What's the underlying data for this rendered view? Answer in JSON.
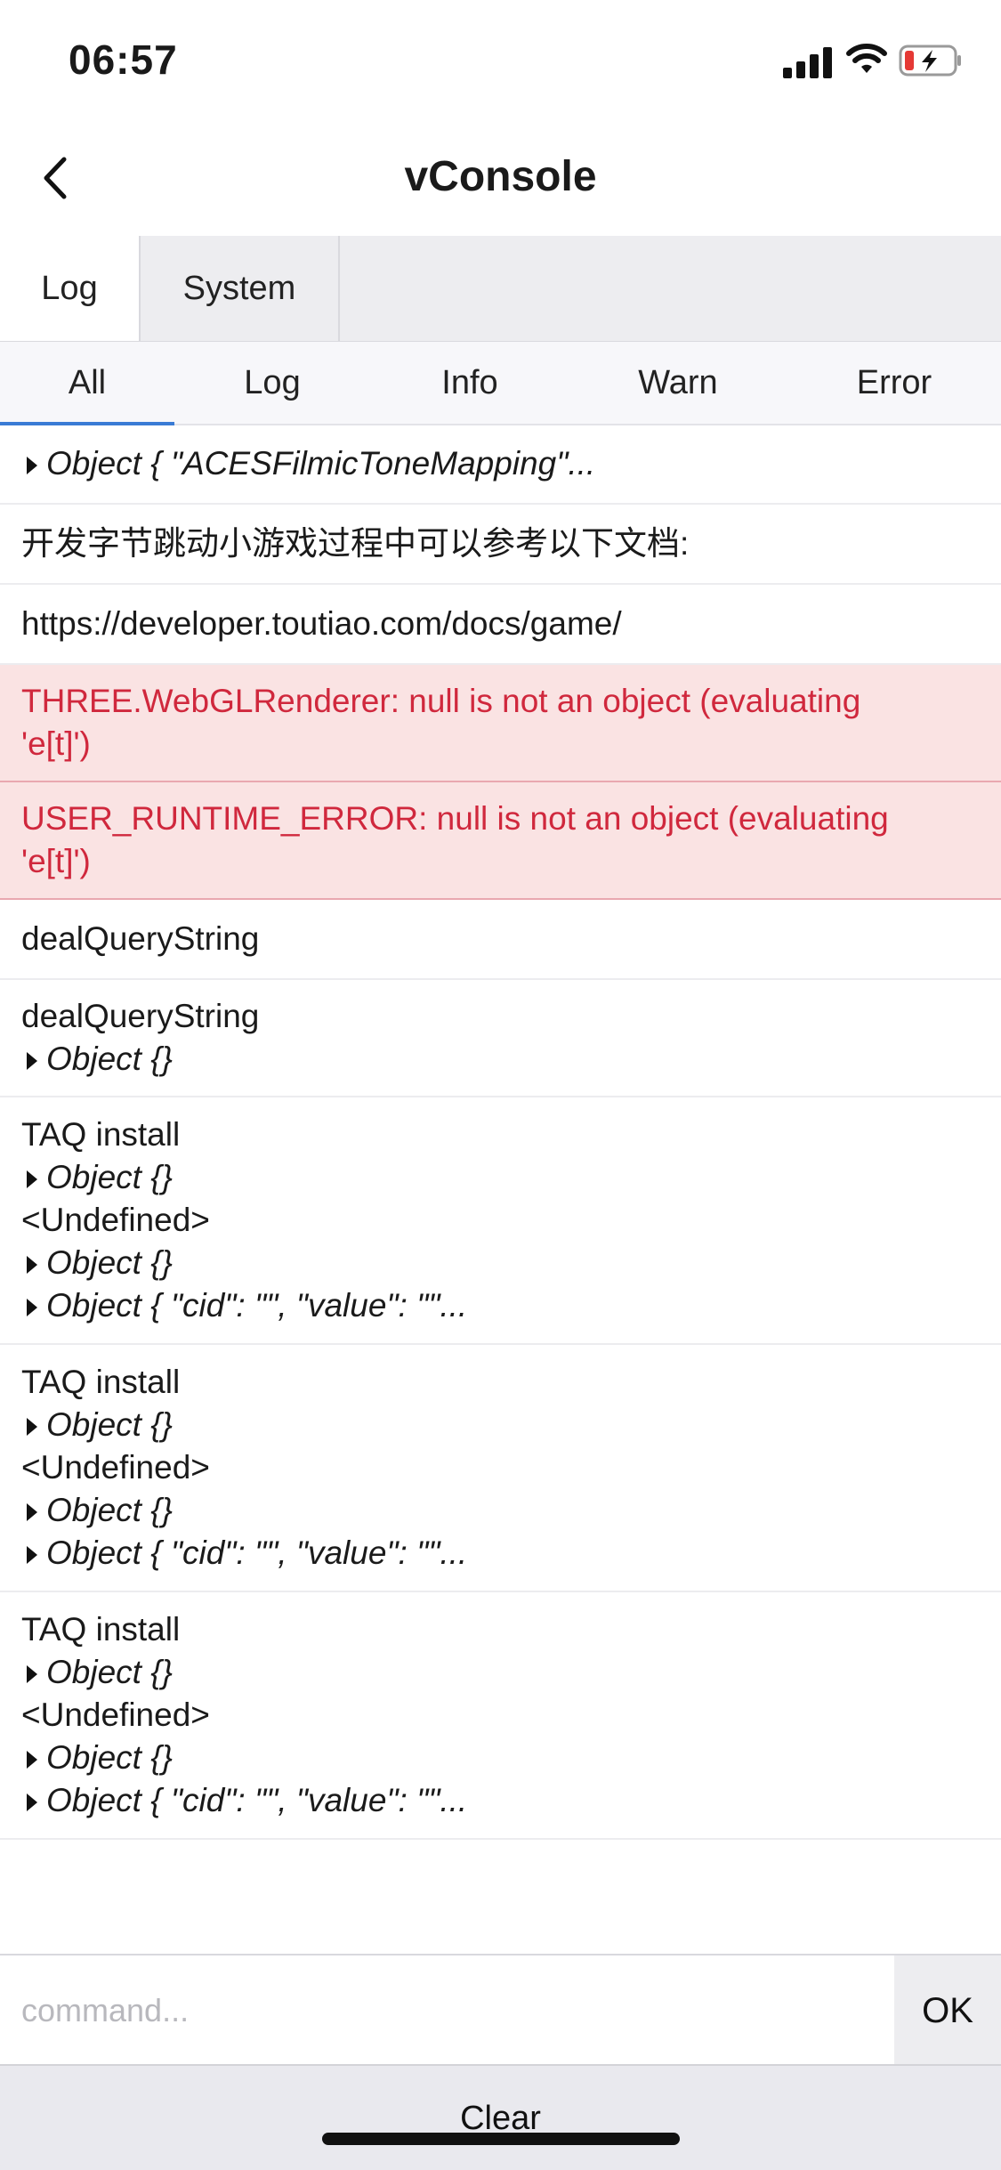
{
  "status": {
    "time": "06:57"
  },
  "nav": {
    "title": "vConsole"
  },
  "top_tabs": [
    "Log",
    "System"
  ],
  "sub_tabs": [
    "All",
    "Log",
    "Info",
    "Warn",
    "Error"
  ],
  "logs": [
    {
      "type": "log",
      "lines": [
        {
          "kind": "obj",
          "text": "Object { \"ACESFilmicToneMapping\"..."
        }
      ]
    },
    {
      "type": "log",
      "lines": [
        {
          "kind": "text",
          "text": "开发字节跳动小游戏过程中可以参考以下文档:"
        }
      ]
    },
    {
      "type": "log",
      "lines": [
        {
          "kind": "text",
          "text": "https://developer.toutiao.com/docs/game/"
        }
      ]
    },
    {
      "type": "error",
      "lines": [
        {
          "kind": "text",
          "text": "THREE.WebGLRenderer: null is not an object (evaluating"
        },
        {
          "kind": "text",
          "text": "'e[t]')"
        }
      ]
    },
    {
      "type": "error",
      "lines": [
        {
          "kind": "text",
          "text": "USER_RUNTIME_ERROR: null is not an object (evaluating"
        },
        {
          "kind": "text",
          "text": "'e[t]')"
        }
      ]
    },
    {
      "type": "log",
      "lines": [
        {
          "kind": "text",
          "text": "dealQueryString"
        }
      ]
    },
    {
      "type": "log",
      "lines": [
        {
          "kind": "text",
          "text": "dealQueryString"
        },
        {
          "kind": "obj",
          "text": "Object {}"
        }
      ]
    },
    {
      "type": "log",
      "lines": [
        {
          "kind": "text",
          "text": "TAQ install"
        },
        {
          "kind": "obj",
          "text": "Object {}"
        },
        {
          "kind": "text",
          "text": "<Undefined>"
        },
        {
          "kind": "obj",
          "text": "Object {}"
        },
        {
          "kind": "obj",
          "text": "Object { \"cid\": \"\", \"value\": \"\"..."
        }
      ]
    },
    {
      "type": "log",
      "lines": [
        {
          "kind": "text",
          "text": "TAQ install"
        },
        {
          "kind": "obj",
          "text": "Object {}"
        },
        {
          "kind": "text",
          "text": "<Undefined>"
        },
        {
          "kind": "obj",
          "text": "Object {}"
        },
        {
          "kind": "obj",
          "text": "Object { \"cid\": \"\", \"value\": \"\"..."
        }
      ]
    },
    {
      "type": "log",
      "lines": [
        {
          "kind": "text",
          "text": "TAQ install"
        },
        {
          "kind": "obj",
          "text": "Object {}"
        },
        {
          "kind": "text",
          "text": "<Undefined>"
        },
        {
          "kind": "obj",
          "text": "Object {}"
        },
        {
          "kind": "obj",
          "text": "Object { \"cid\": \"\", \"value\": \"\"..."
        }
      ]
    }
  ],
  "command": {
    "placeholder": "command...",
    "ok_label": "OK"
  },
  "bottom": {
    "clear_label": "Clear"
  }
}
